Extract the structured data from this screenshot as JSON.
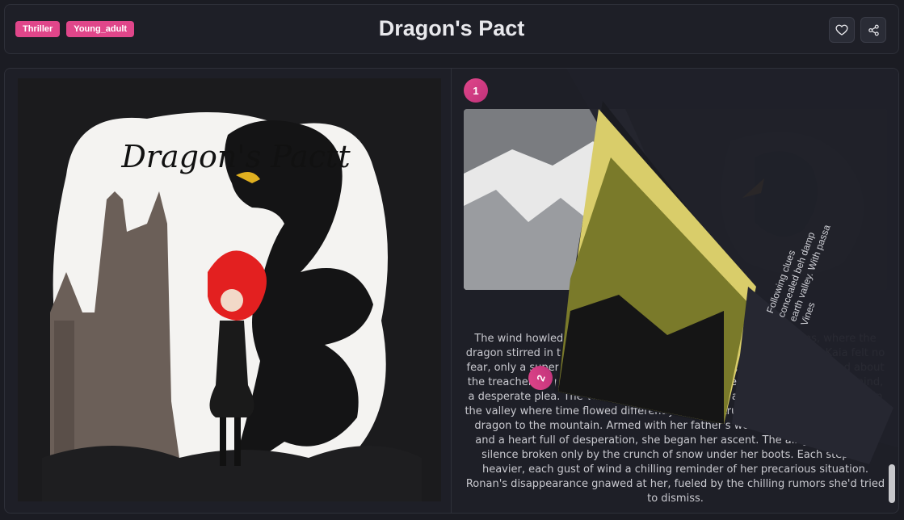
{
  "header": {
    "tags": [
      "Thriller",
      "Young_adult"
    ],
    "title": "Dragon's Pact",
    "like_icon": "heart-icon",
    "share_icon": "share-icon"
  },
  "cover": {
    "art_title": "Dragon's Pactt"
  },
  "page1": {
    "number": "1",
    "text": "The wind howled through the jagged peaks of ancient mountains, where the dragon stirred in the shadows. Its scales were as dark as the storm. Kaia felt no fear, only a superstition carried from her childhood, a warning whispered about the treacherous path. Her brother's words from the village echoed in her mind, a desperate plea. The villagers spoke of a dragon and a pact made long ago in the valley where time flowed differently, a pact struck ages ago, that bound the dragon to the mountain. Armed with her father's worn leather-bound journal and a heart full of desperation, she began her ascent. The air grew thin, the silence broken only by the crunch of snow under her boots. Each step felt heavier, each gust of wind a chilling reminder of her precarious situation. Ronan's disappearance gnawed at her, fueled by the chilling rumors she'd tried to dismiss."
  },
  "page2": {
    "number": "2",
    "text_fragment": "Following clues concealed beh damp earth valley. With passa Vines"
  }
}
